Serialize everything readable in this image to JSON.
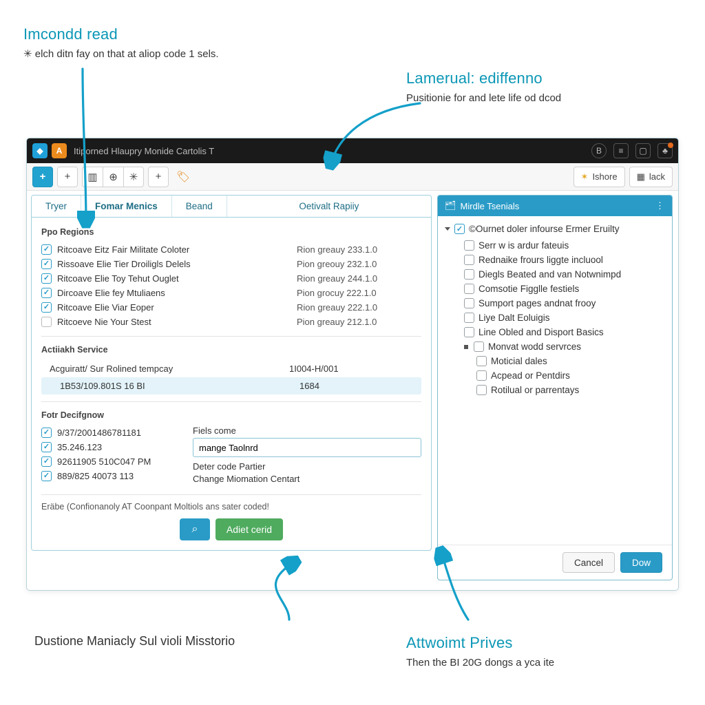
{
  "annotations": {
    "a1_title": "Imcondd read",
    "a1_sub": "✳ elch ditn fay on that at aliop code 1 sels.",
    "a2_title": "Lamerual: ediffenno",
    "a2_sub": "Pusitionie for and lete life od dcod",
    "a3_title": "Attwoimt Prives",
    "a3_sub": "Then the BI 20G dongs a yca ite",
    "a4": "Dustione Maniacly Sul violi Misstorio"
  },
  "window": {
    "title": "Itiporned Hlaupry Monide Cartolis T"
  },
  "toolbar": {
    "ishore": "Ishore",
    "lack": "lack"
  },
  "tabs": [
    "Tryer",
    "Fomar Menics",
    "Beand",
    "Oetivalt Rapiiy"
  ],
  "section_regions": {
    "label": "Ppo Regions",
    "rows": [
      {
        "on": true,
        "label": "Ritcoave Eitz Fair Militate Coloter",
        "val": "Rion greauy 233.1.0"
      },
      {
        "on": true,
        "label": "Rissoave Elie Tier Droiligls Delels",
        "val": "Pion greouy 232.1.0"
      },
      {
        "on": true,
        "label": "Ritcoave Elie Toy Tehut Ouglet",
        "val": "Rion greauy 244.1.0"
      },
      {
        "on": true,
        "label": "Dircoave Elie fey Mtuliaens",
        "val": "Pion grocuy 222.1.0"
      },
      {
        "on": true,
        "label": "Ritcoave Elie Viar Eoper",
        "val": "Rion greauy 222.1.0"
      },
      {
        "on": false,
        "label": "Ritcoeve Nie Your Stest",
        "val": "Pion greauy 212.1.0"
      }
    ]
  },
  "section_service": {
    "label": "Actiiakh Service",
    "rows": [
      {
        "on": true,
        "label": "Acguiratt/ Sur Rolined tempcay",
        "val": "1I004-H/001",
        "hl": false
      },
      {
        "on": null,
        "label": "1B53/109.801S 16 BI",
        "val": "1684",
        "hl": true
      }
    ]
  },
  "section_design": {
    "label": "Fotr Decifgnow",
    "left": [
      {
        "on": true,
        "label": "9/37/2001486781181"
      },
      {
        "on": true,
        "label": "35.246.123"
      },
      {
        "on": true,
        "label": "92611905 510C047 PM"
      },
      {
        "on": true,
        "label": "889/825 40073 113"
      }
    ],
    "right_field_label": "Fiels come",
    "input_value": "mange Taolnrd",
    "right_lines": [
      "Deter code Partier",
      "Change Miomation Centart"
    ]
  },
  "hint": "Eräbe (Confionanoly AT Coonpant Moltiols ans sater coded!",
  "buttons": {
    "search_icon": "⌕",
    "adiet": "Adiet cerid"
  },
  "right_panel": {
    "header": "Mirdle Tsenials",
    "root": {
      "on": true,
      "label": "©Ournet doler infourse Ermer Eruilty"
    },
    "children": [
      "Serr w is ardur fateuis",
      "Rednaike frours liggte incluool",
      "Diegls Beated and van Notwnimpd",
      "Comsotie Figglle festiels",
      "Sumport pages andnat frooy",
      "Liye Dalt Eoluigis",
      "Line Obled and Disport Basics"
    ],
    "sub_label": "Monvat wodd servrces",
    "sub_children": [
      "Moticial dales",
      "Acpead or Pentdirs",
      "Rotilual or parrentays"
    ],
    "cancel": "Cancel",
    "dow": "Dow"
  }
}
